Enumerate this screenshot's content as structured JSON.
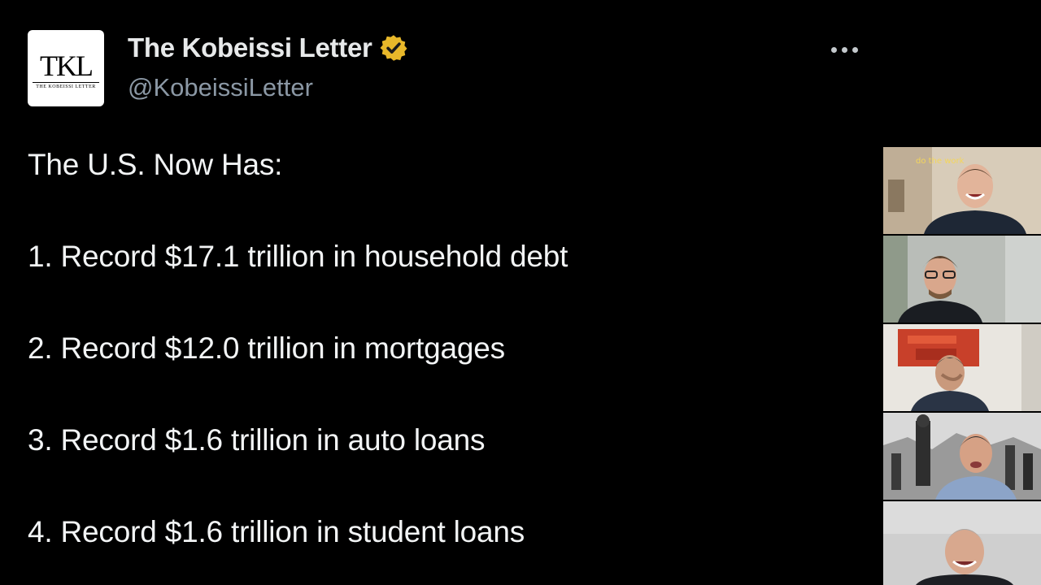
{
  "author": {
    "name": "The Kobeissi Letter",
    "handle": "@KobeissiLetter",
    "avatar_monogram": "TKL",
    "avatar_subtitle": "THE KOBEISSI LETTER",
    "verified_badge_color": "#e8b82a",
    "verified_icon": "verified-badge-icon"
  },
  "tweet": {
    "intro": "The U.S. Now Has:",
    "items": [
      "1. Record $17.1 trillion in household debt",
      "2. Record $12.0 trillion in mortgages",
      "3. Record $1.6 trillion in auto loans",
      "4. Record $1.6 trillion in student loans"
    ]
  },
  "menu": {
    "icon": "more-options-icon"
  },
  "video_call": {
    "participants": [
      {
        "id": "participant-1",
        "wall_text": "do the work"
      },
      {
        "id": "participant-2"
      },
      {
        "id": "participant-3"
      },
      {
        "id": "participant-4"
      },
      {
        "id": "participant-5"
      }
    ]
  },
  "colors": {
    "background": "#000000",
    "text_primary": "#e7e9ea",
    "text_secondary": "#8b98a5",
    "badge": "#e8b82a",
    "neon_sign": "#f4d65a"
  }
}
